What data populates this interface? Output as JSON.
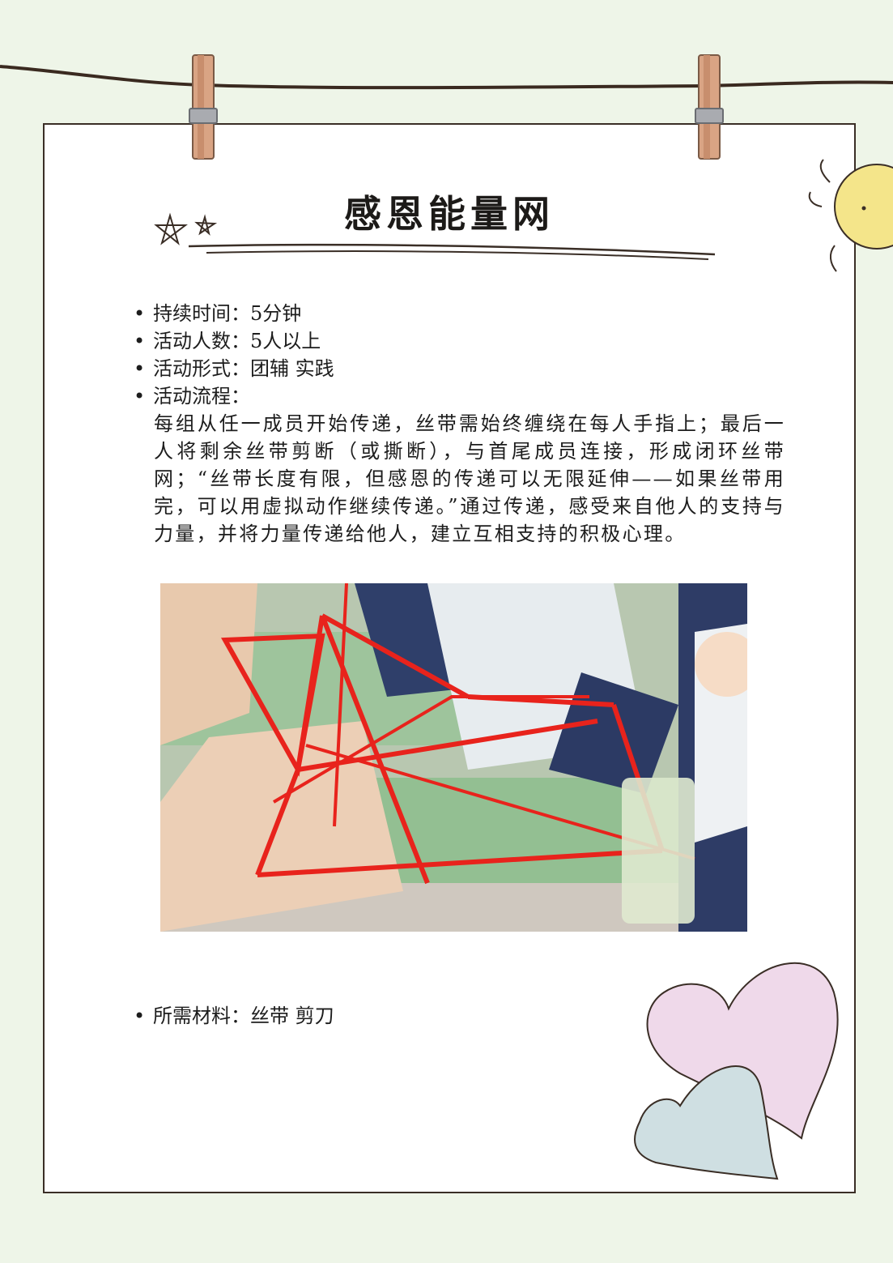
{
  "title": "感恩能量网",
  "info": [
    {
      "label": "持续时间：",
      "value": "5分钟"
    },
    {
      "label": "活动人数：",
      "value": "5人以上"
    },
    {
      "label": "活动形式：",
      "value": "团辅 实践"
    },
    {
      "label": "活动流程：",
      "value": ""
    }
  ],
  "process_text": "每组从任一成员开始传递，丝带需始终缠绕在每人手指上；最后一人将剩余丝带剪断（或撕断），与首尾成员连接，形成闭环丝带网；“丝带长度有限，但感恩的传递可以无限延伸——如果丝带用完，可以用虚拟动作继续传递。”通过传递，感受来自他人的支持与力量，并将力量传递给他人，建立互相支持的积极心理。",
  "materials": {
    "label": "所需材料：",
    "value": "丝带 剪刀"
  },
  "colors": {
    "background": "#eef5e8",
    "border": "#3a2e26",
    "ribbon": "#e8231c",
    "heart_pink": "#efd9ea",
    "heart_blue": "#cfdfe2",
    "sun": "#f4e58a"
  },
  "icons": [
    "clothespin-icon",
    "sun-icon",
    "star-doodle-icon",
    "heart-icon"
  ]
}
